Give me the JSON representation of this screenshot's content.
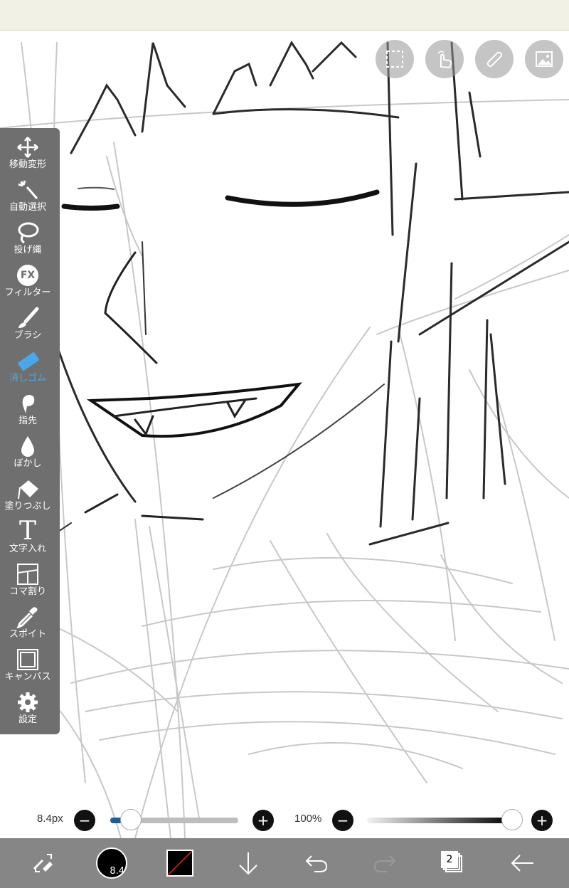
{
  "toolbar": {
    "tools": [
      {
        "id": "move",
        "label": "移動変形"
      },
      {
        "id": "magic-wand",
        "label": "自動選択"
      },
      {
        "id": "lasso",
        "label": "投げ縄"
      },
      {
        "id": "filter",
        "label": "フィルター",
        "icon_text": "FX"
      },
      {
        "id": "brush",
        "label": "ブラシ"
      },
      {
        "id": "eraser",
        "label": "消しゴム",
        "active": true
      },
      {
        "id": "smudge",
        "label": "指先"
      },
      {
        "id": "blur",
        "label": "ぼかし"
      },
      {
        "id": "fill",
        "label": "塗りつぶし"
      },
      {
        "id": "text",
        "label": "文字入れ",
        "icon_text": "T"
      },
      {
        "id": "frame-divider",
        "label": "コマ割り"
      },
      {
        "id": "eyedropper",
        "label": "スポイト"
      },
      {
        "id": "canvas",
        "label": "キャンバス"
      },
      {
        "id": "settings",
        "label": "設定"
      }
    ],
    "active_color": "#4aa8e8"
  },
  "top_buttons": [
    "selection-icon",
    "gesture-icon",
    "ruler-icon",
    "image-icon"
  ],
  "sliders": {
    "size_label": "8.4px",
    "size_fraction": 0.16,
    "opacity_label": "100%",
    "opacity_fraction": 1.0,
    "minus": "−",
    "plus": "+"
  },
  "bottom_bar": {
    "brush_size_text": "8.4",
    "layer_count": "2",
    "current_color": "#000000"
  }
}
